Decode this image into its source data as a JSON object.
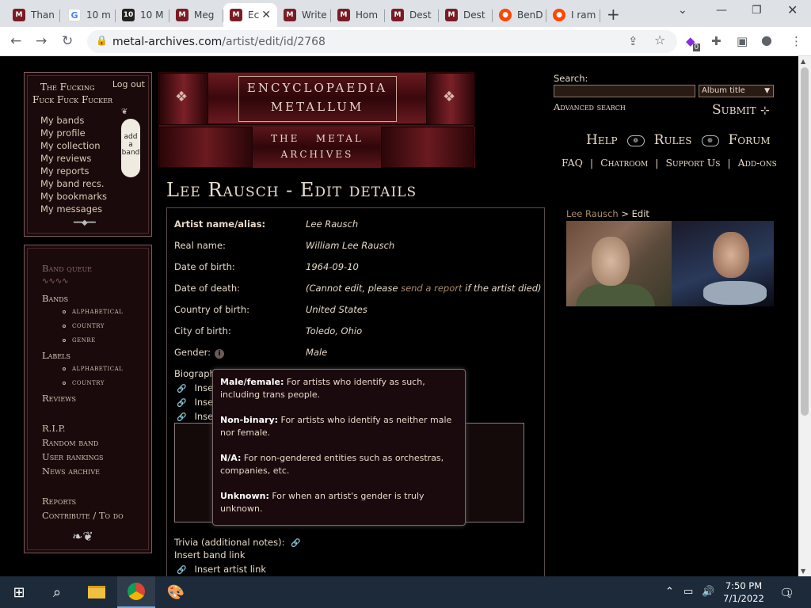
{
  "browser": {
    "tabs": [
      {
        "label": "Than",
        "favicon": "ma"
      },
      {
        "label": "10 m",
        "favicon": "g"
      },
      {
        "label": "10 M",
        "favicon": "ten"
      },
      {
        "label": "Meg",
        "favicon": "ma"
      },
      {
        "label": "Ec",
        "favicon": "ma",
        "active": true
      },
      {
        "label": "Write",
        "favicon": "ma"
      },
      {
        "label": "Hom",
        "favicon": "ma"
      },
      {
        "label": "Dest",
        "favicon": "ma"
      },
      {
        "label": "Dest",
        "favicon": "ma"
      },
      {
        "label": "BenD",
        "favicon": "rd"
      },
      {
        "label": "I ram",
        "favicon": "rd"
      }
    ],
    "url_host": "metal-archives.com",
    "url_path": "/artist/edit/id/2768",
    "extension_badge": "0"
  },
  "user": {
    "title_line1": "The Fucking",
    "title_line2": "Fuck Fuck Fucker",
    "logout": "Log out",
    "menu": [
      "My bands",
      "My profile",
      "My collection",
      "My reviews",
      "My reports",
      "My band recs.",
      "My bookmarks",
      "My messages"
    ],
    "add_band": [
      "add",
      "a",
      "band"
    ]
  },
  "sidenav": {
    "band_queue": "Band queue",
    "bands": "Bands",
    "bands_sub": [
      "alphabetical",
      "country",
      "genre"
    ],
    "labels": "Labels",
    "labels_sub": [
      "alphabetical",
      "country"
    ],
    "reviews": "Reviews",
    "rip": "R.I.P.",
    "random_band": "Random band",
    "user_rankings": "User rankings",
    "news_archive": "News archive",
    "reports": "Reports",
    "contribute": "Contribute / To do"
  },
  "banner": {
    "line1": "ENCYCLOPAEDIA",
    "line2": "METALLUM",
    "line3": "THE   METAL",
    "line4": "ARCHIVES"
  },
  "search": {
    "label": "Search:",
    "select_value": "Album title",
    "advanced": "Advanced search",
    "submit": "Submit"
  },
  "topnav": {
    "help": "Help",
    "rules": "Rules",
    "forum": "Forum"
  },
  "subnav": [
    "FAQ",
    "Chatroom",
    "Support Us",
    "Add-ons"
  ],
  "page": {
    "title": "Lee Rausch - Edit details",
    "breadcrumb_link": "Lee Rausch",
    "breadcrumb_rest": " > Edit"
  },
  "form": {
    "fields": [
      {
        "label": "Artist name/alias:",
        "value": "Lee Rausch"
      },
      {
        "label": "Real name:",
        "value": "William Lee Rausch"
      },
      {
        "label": "Date of birth:",
        "value": "1964-09-10"
      },
      {
        "label": "Date of death:",
        "value_pre": "(Cannot edit, please ",
        "value_link": "send a report",
        "value_post": " if the artist died)"
      },
      {
        "label": "Country of birth:",
        "value": "United States"
      },
      {
        "label": "City of birth:",
        "value": "Toledo, Ohio"
      },
      {
        "label": "Gender:",
        "value": "Male"
      }
    ],
    "biography_label": "Biograph",
    "insert_lines": [
      "Insert",
      "Inser",
      "Inser"
    ],
    "trivia_label": "Trivia (additional notes):",
    "insert_band_link": "Insert band link",
    "insert_artist_link": "Insert artist link"
  },
  "tooltip": {
    "items": [
      {
        "term": "Male/female:",
        "desc": " For artists who identify as such, including trans people."
      },
      {
        "term": "Non-binary:",
        "desc": " For artists who identify as neither male nor female."
      },
      {
        "term": "N/A:",
        "desc": " For non-gendered entities such as orchestras, companies, etc."
      },
      {
        "term": "Unknown:",
        "desc": " For when an artist's gender is truly unknown."
      }
    ]
  },
  "taskbar": {
    "time": "7:50 PM",
    "date": "7/1/2022",
    "notif_count": "1"
  }
}
